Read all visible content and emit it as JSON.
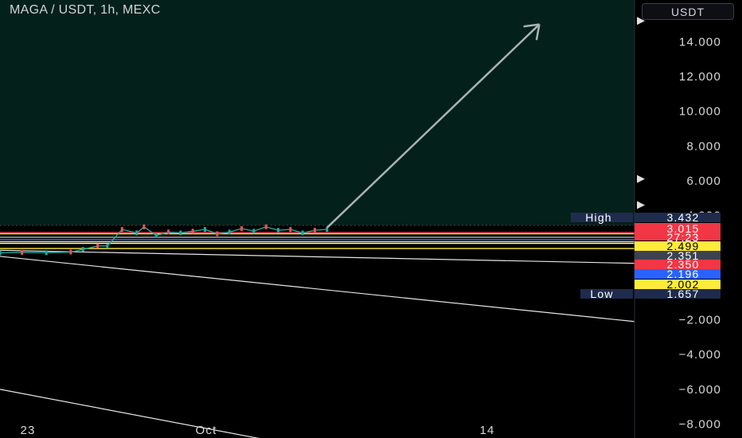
{
  "header": {
    "symbol_title": "MAGA / USDT, 1h, MEXC",
    "currency_button": "USDT"
  },
  "colors": {
    "background": "#000000",
    "upper_zone": "#04201a",
    "trend_arrow": "#a9b3b3",
    "tag_dark": "#1f2b4d",
    "tag_red": "#f23645",
    "tag_yellow": "#ffeb3b",
    "tag_gray": "#3d4150",
    "tag_blue": "#2962ff",
    "line_white": "#e6e6e6"
  },
  "chart_data": {
    "type": "line",
    "title": "MAGA / USDT, 1h, MEXC",
    "ylim": [
      -8.8,
      16.4
    ],
    "y_ticks": [
      {
        "value": 14,
        "label": "14.000"
      },
      {
        "value": 12,
        "label": "12.000"
      },
      {
        "value": 10,
        "label": "10.000"
      },
      {
        "value": 8,
        "label": "8.000"
      },
      {
        "value": 6,
        "label": "6.000"
      },
      {
        "value": 4,
        "label": "4.000"
      },
      {
        "value": -2,
        "label": "−2.000"
      },
      {
        "value": -4,
        "label": "−4.000"
      },
      {
        "value": -6,
        "label": "−6.000"
      },
      {
        "value": -8,
        "label": "−8.000"
      }
    ],
    "x_ticks": [
      {
        "value": 0,
        "label": "23"
      },
      {
        "value": 8,
        "label": "Oct"
      },
      {
        "value": 21,
        "label": "14"
      }
    ],
    "xlim": [
      -1.4,
      24.6
    ],
    "price_series": {
      "name": "",
      "x": [
        -1.4,
        -0.5,
        0.5,
        1.5,
        2.0,
        2.6,
        3.0,
        3.6,
        4.2,
        4.5,
        5.0,
        5.5,
        6.0,
        6.5,
        7.0,
        7.5,
        8.0,
        8.5,
        9.0,
        9.5,
        10.0,
        10.5,
        11.0,
        11.5,
        12.0
      ],
      "values": [
        1.85,
        1.88,
        1.86,
        1.9,
        2.05,
        2.25,
        2.25,
        3.2,
        3.0,
        3.35,
        2.85,
        3.05,
        3.0,
        3.1,
        3.2,
        2.95,
        3.05,
        3.25,
        3.1,
        3.35,
        3.15,
        3.2,
        3.0,
        3.15,
        3.2
      ]
    },
    "forecast_arrow": {
      "from": [
        12.0,
        3.3
      ],
      "to": [
        20.7,
        15.0
      ]
    },
    "horizontal_levels": [
      {
        "value": 3.015,
        "color": "#f23645"
      },
      {
        "value": 2.95,
        "color": "#ffeb3b"
      },
      {
        "value": 2.75,
        "color": "#b2b5be"
      },
      {
        "value": 2.62,
        "color": "#2962ff"
      },
      {
        "value": 2.499,
        "color": "#ffeb3b"
      },
      {
        "value": 2.4,
        "color": "#ffffff"
      },
      {
        "value": 2.1,
        "color": "#ffeb3b"
      }
    ],
    "trend_lines": [
      {
        "from": [
          -1.4,
          2.0
        ],
        "to": [
          24.6,
          1.25
        ]
      },
      {
        "from": [
          -1.4,
          1.65
        ],
        "to": [
          24.6,
          -2.1
        ]
      },
      {
        "from": [
          -1.4,
          -6.0
        ],
        "to": [
          11.0,
          -9.3
        ]
      }
    ],
    "price_tags": [
      {
        "value": 3.432,
        "label": "3.432",
        "caption": "High",
        "bg": "#1f2b4d",
        "fg": "#ffffff"
      },
      {
        "value": 3.015,
        "label": "3.015",
        "sub_label": "27:23",
        "bg": "#f23645",
        "fg": "#ffffff"
      },
      {
        "value": 2.499,
        "label": "2.499",
        "bg": "#ffeb3b",
        "fg": "#000000"
      },
      {
        "value": 2.351,
        "label": "2.351",
        "bg": "#3d4150",
        "fg": "#ffffff"
      },
      {
        "value": 2.35,
        "label": "2.350",
        "bg": "#f23645",
        "fg": "#ffffff"
      },
      {
        "value": 2.196,
        "label": "2.196",
        "bg": "#2962ff",
        "fg": "#ffffff"
      },
      {
        "value": 2.002,
        "label": "2.002",
        "bg": "#ffeb3b",
        "fg": "#000000"
      },
      {
        "value": 1.657,
        "label": "1.657",
        "caption": "Low",
        "bg": "#1f2b4d",
        "fg": "#ffffff"
      }
    ],
    "alert_markers": [
      15.2,
      6.1,
      4.6
    ]
  }
}
